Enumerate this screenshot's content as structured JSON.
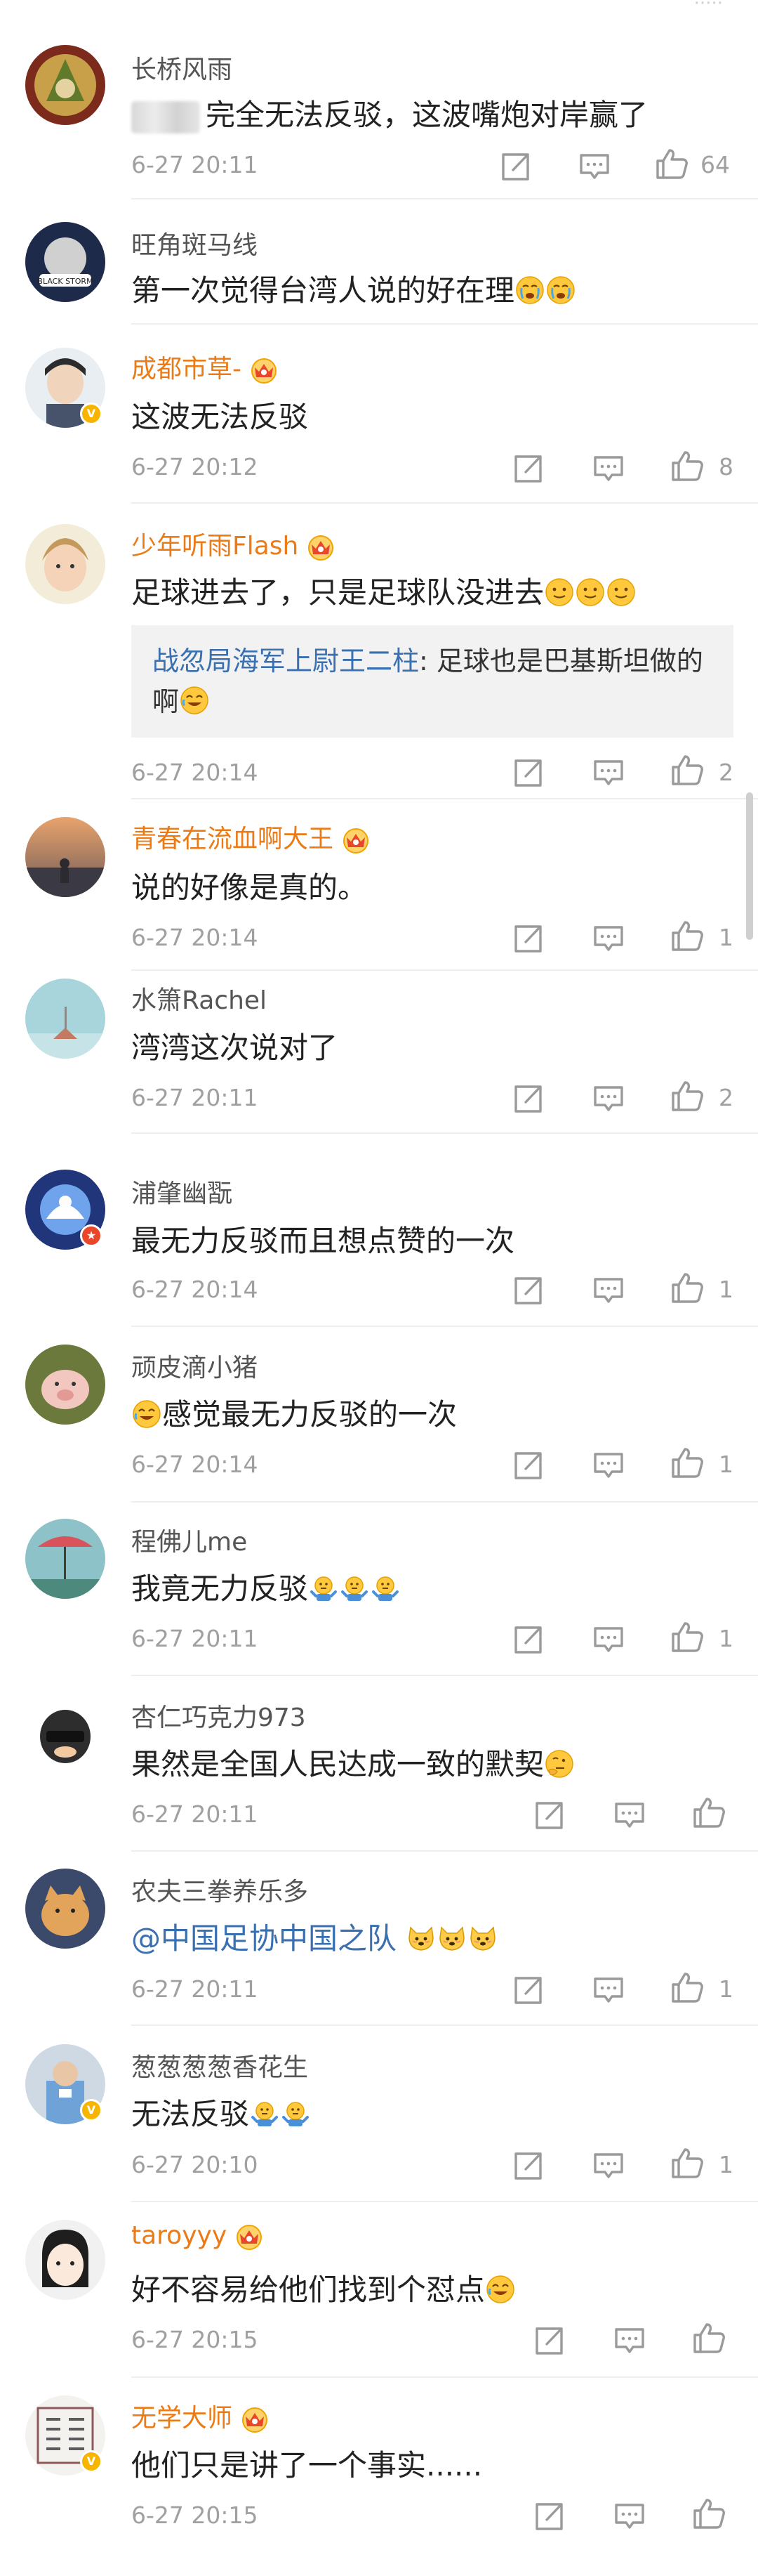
{
  "top_fade": "·····",
  "comments": [
    {
      "name": "长桥风雨",
      "text": "完全无法反驳，这波嘴炮对岸赢了",
      "time": "6-27 20:11",
      "likes": "64"
    },
    {
      "name": "旺角斑马线",
      "text": "第一次觉得台湾人说的好在理",
      "time": "",
      "likes": ""
    },
    {
      "name": "成都市草-",
      "text": "这波无法反驳",
      "time": "6-27 20:12",
      "likes": "8"
    },
    {
      "name": "少年听雨Flash",
      "text": "足球进去了，只是足球队没进去",
      "time": "6-27 20:14",
      "likes": "2",
      "reply": {
        "name": "战忽局海军上尉王二柱",
        "text": ": 足球也是巴基斯坦做的啊"
      }
    },
    {
      "name": "青春在流血啊大王",
      "text": "说的好像是真的。",
      "time": "6-27 20:14",
      "likes": "1"
    },
    {
      "name": "水箫Rachel",
      "text": "湾湾这次说对了",
      "time": "6-27 20:11",
      "likes": "2"
    },
    {
      "name": "浦肇幽翫",
      "text": "最无力反驳而且想点赞的一次",
      "time": "6-27 20:14",
      "likes": "1"
    },
    {
      "name": "顽皮滴小猪",
      "text": "感觉最无力反驳的一次",
      "time": "6-27 20:14",
      "likes": "1"
    },
    {
      "name": "程佛儿me",
      "text": "我竟无力反驳",
      "time": "6-27 20:11",
      "likes": "1"
    },
    {
      "name": "杏仁巧克力973",
      "text": "果然是全国人民达成一致的默契",
      "time": "6-27 20:11",
      "likes": ""
    },
    {
      "name": "农夫三拳养乐多",
      "text": "@中国足协中国之队",
      "time": "6-27 20:11",
      "likes": "1"
    },
    {
      "name": "葱葱葱葱香花生",
      "text": "无法反驳",
      "time": "6-27 20:10",
      "likes": "1"
    },
    {
      "name": "taroyyy",
      "text": "好不容易给他们找到个怼点",
      "time": "6-27 20:15",
      "likes": ""
    },
    {
      "name": "无学大师",
      "text": "他们只是讲了一个事实......",
      "time": "6-27 20:15",
      "likes": ""
    }
  ],
  "colors": {
    "orange_name": "#eb7b16",
    "gray_name": "#555555",
    "link": "#3a6fb0",
    "meta": "#a0a0a0"
  },
  "icons": [
    "share-icon",
    "comment-icon",
    "like-icon",
    "vip-crown-icon",
    "verified-badge-icon"
  ]
}
